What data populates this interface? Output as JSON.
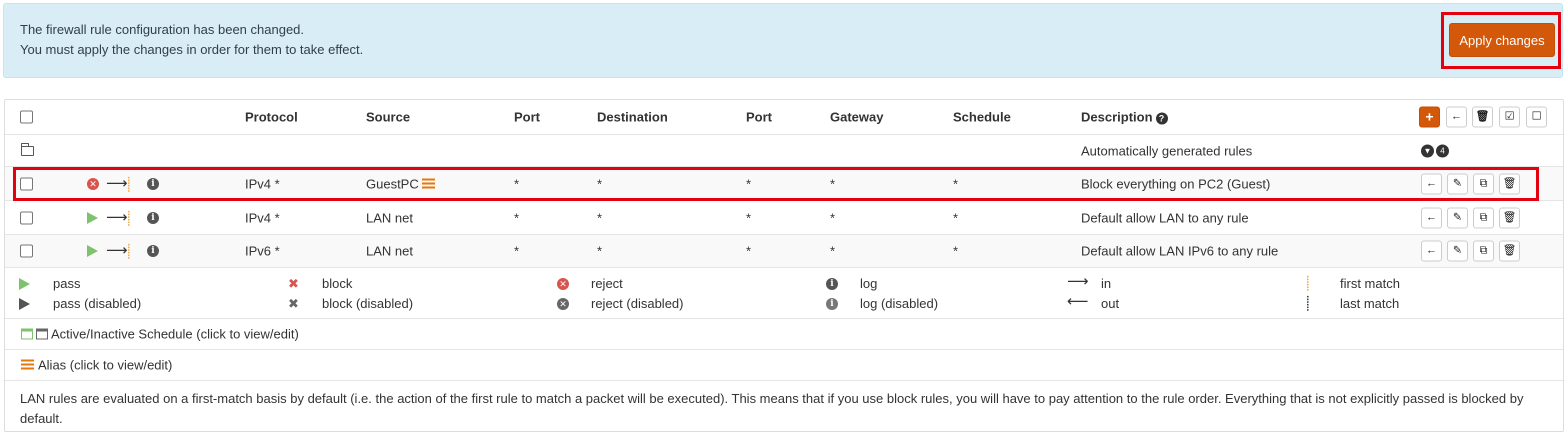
{
  "alert": {
    "line1": "The firewall rule configuration has been changed.",
    "line2": "You must apply the changes in order for them to take effect.",
    "apply_label": "Apply changes"
  },
  "table": {
    "headers": {
      "protocol": "Protocol",
      "source": "Source",
      "port": "Port",
      "destination": "Destination",
      "port2": "Port",
      "gateway": "Gateway",
      "schedule": "Schedule",
      "description": "Description"
    },
    "auto_row": {
      "description": "Automatically generated rules"
    },
    "rules": [
      {
        "action": "reject",
        "protocol": "IPv4 *",
        "source": "GuestPC",
        "source_alias": true,
        "port": "*",
        "destination": "*",
        "dport": "*",
        "gateway": "*",
        "schedule": "*",
        "description": "Block everything on PC2 (Guest)"
      },
      {
        "action": "pass",
        "protocol": "IPv4 *",
        "source": "LAN net",
        "source_alias": false,
        "port": "*",
        "destination": "*",
        "dport": "*",
        "gateway": "*",
        "schedule": "*",
        "description": "Default allow LAN to any rule"
      },
      {
        "action": "pass",
        "protocol": "IPv6 *",
        "source": "LAN net",
        "source_alias": false,
        "port": "*",
        "destination": "*",
        "dport": "*",
        "gateway": "*",
        "schedule": "*",
        "description": "Default allow LAN IPv6 to any rule"
      }
    ]
  },
  "legend": {
    "pass": "pass",
    "pass_disabled": "pass (disabled)",
    "block": "block",
    "block_disabled": "block (disabled)",
    "reject": "reject",
    "reject_disabled": "reject (disabled)",
    "log": "log",
    "log_disabled": "log (disabled)",
    "in": "in",
    "out": "out",
    "first_match": "first match",
    "last_match": "last match"
  },
  "schedule_note": "Active/Inactive Schedule (click to view/edit)",
  "alias_note": "Alias (click to view/edit)",
  "footer_note": "LAN rules are evaluated on a first-match basis by default (i.e. the action of the first rule to match a packet will be executed). This means that if you use block rules, you will have to pay attention to the rule order. Everything that is not explicitly passed is blocked by default.",
  "colors": {
    "accent": "#d4580a",
    "alert_bg": "#d9edf7",
    "highlight": "#e3000f",
    "pass": "#7ec36b",
    "reject": "#d9534f",
    "match": "#f0ad4e"
  }
}
